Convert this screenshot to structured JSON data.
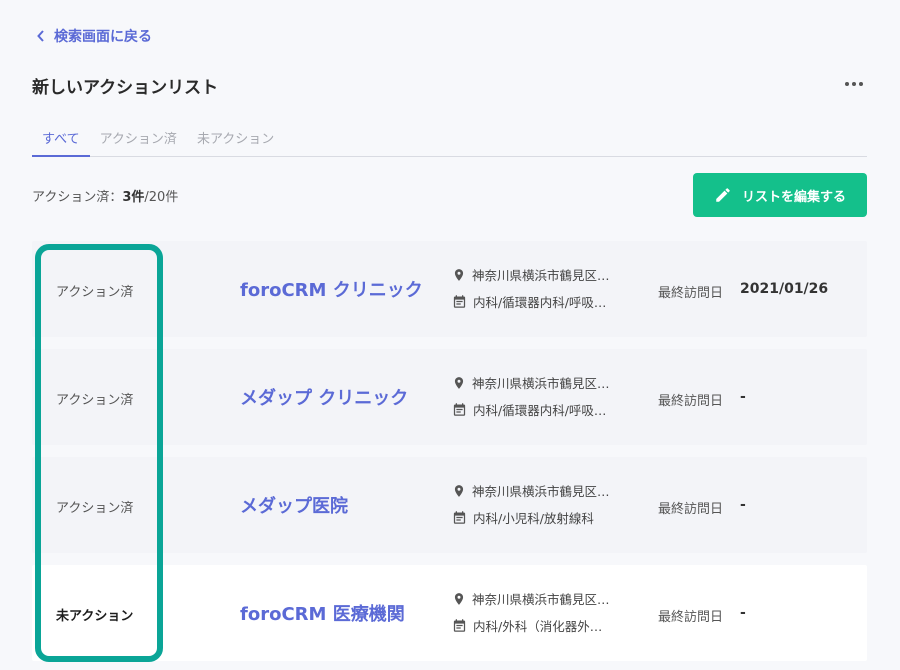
{
  "nav": {
    "back_label": "検索画面に戻る"
  },
  "page": {
    "title": "新しいアクションリスト"
  },
  "tabs": [
    {
      "label": "すべて",
      "active": true
    },
    {
      "label": "アクション済",
      "active": false
    },
    {
      "label": "未アクション",
      "active": false
    }
  ],
  "summary": {
    "prefix": "アクション済：",
    "count": "3件",
    "total": "/20件"
  },
  "toolbar": {
    "edit_label": "リストを編集する"
  },
  "colors": {
    "accent": "#5b6ad6",
    "button": "#14c08b",
    "highlight": "#0aa597"
  },
  "rows": [
    {
      "status": "アクション済",
      "name": "foroCRM クリニック",
      "address": "神奈川県横浜市鶴見区…",
      "departments": "内科/循環器内科/呼吸…",
      "visit_label": "最終訪問日",
      "visit_value": "2021/01/26",
      "actioned": true
    },
    {
      "status": "アクション済",
      "name": "メダップ クリニック",
      "address": "神奈川県横浜市鶴見区…",
      "departments": "内科/循環器内科/呼吸…",
      "visit_label": "最終訪問日",
      "visit_value": "-",
      "actioned": true
    },
    {
      "status": "アクション済",
      "name": "メダップ医院",
      "address": "神奈川県横浜市鶴見区…",
      "departments": "内科/小児科/放射線科",
      "visit_label": "最終訪問日",
      "visit_value": "-",
      "actioned": true
    },
    {
      "status": "未アクション",
      "name": "foroCRM 医療機関",
      "address": "神奈川県横浜市鶴見区…",
      "departments": "内科/外科（消化器外…",
      "visit_label": "最終訪問日",
      "visit_value": "-",
      "actioned": false
    }
  ]
}
